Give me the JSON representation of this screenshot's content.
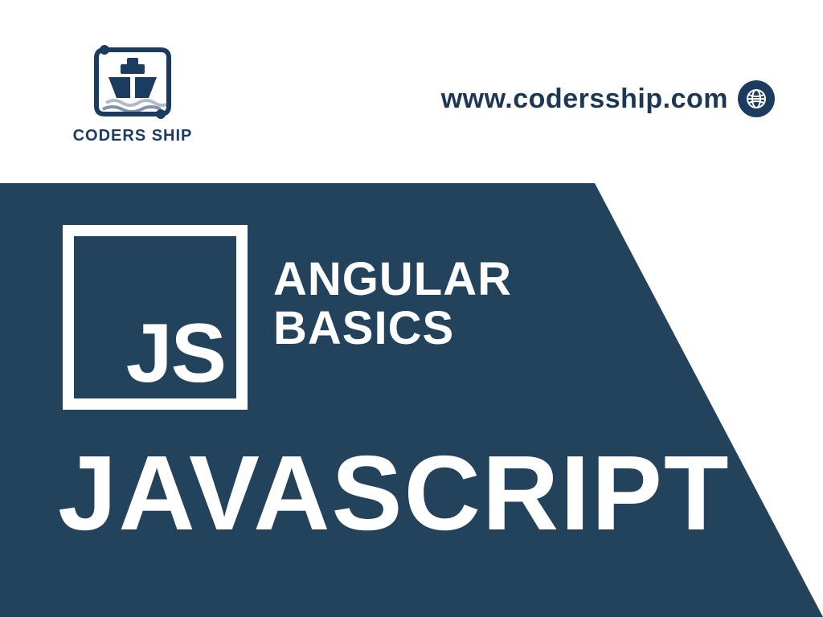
{
  "brand": {
    "name": "CODERS SHIP"
  },
  "url": {
    "text": "www.codersship.com"
  },
  "hero": {
    "badge": "JS",
    "line1": "ANGULAR",
    "line2": "BASICS",
    "title": "JAVASCRIPT"
  },
  "colors": {
    "navy": "#23425c",
    "brand_navy": "#1b3b5f",
    "white": "#ffffff"
  }
}
